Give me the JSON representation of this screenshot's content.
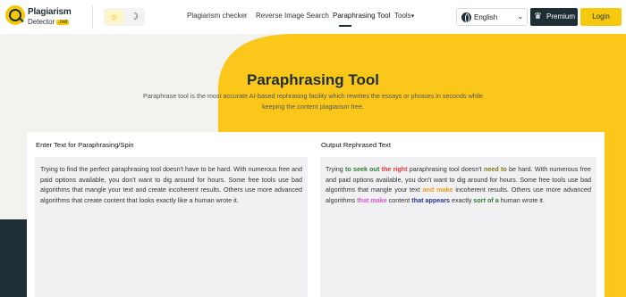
{
  "header": {
    "logo": {
      "line1": "Plagiarism",
      "line2": "Detector",
      "badge": ".net"
    },
    "theme": {
      "light_icon": "sun-icon",
      "dark_icon": "moon-icon"
    },
    "nav": [
      {
        "label": "Plagiarism checker"
      },
      {
        "label": "Reverse Image Search"
      },
      {
        "label": "Paraphrasing Tool",
        "active": true
      },
      {
        "label": "Tools"
      }
    ],
    "tools_chevron": "chevron-down-icon",
    "language": {
      "selected": "English",
      "icon": "globe-icon"
    },
    "premium_label": "Premium",
    "premium_icon": "crown-icon",
    "login_label": "Login"
  },
  "hero": {
    "title": "Paraphrasing Tool",
    "subtitle": "Paraphrase tool is the most accurate AI-based rephrasing facility which rewrites the essays or phrases in seconds while keeping the content plagiarism free."
  },
  "input_panel": {
    "heading": "Enter Text for Paraphrasing/Spin",
    "text": "Trying to find the perfect paraphrasing tool doesn't have to be hard. With numerous free and paid options available, you don't want to dig around for hours. Some free tools use bad algorithms that mangle your text and create incoherent results. Others use more advanced algorithms that create content that looks exactly like a human wrote it."
  },
  "output_panel": {
    "heading": "Output Rephrased Text",
    "segments": [
      {
        "text": "Trying ",
        "color": null
      },
      {
        "text": "to seek out",
        "color": "#2e7d32"
      },
      {
        "text": " ",
        "color": null
      },
      {
        "text": "the right",
        "color": "#e53935"
      },
      {
        "text": " paraphrasing tool doesn't ",
        "color": null
      },
      {
        "text": "need to",
        "color": "#827717"
      },
      {
        "text": " be hard. With numerous free and paid options available, you don't want to dig around for hours. Some free tools use bad algorithms that mangle your text ",
        "color": null
      },
      {
        "text": "and make",
        "color": "#f39c12"
      },
      {
        "text": " incoherent results. Others use more advanced algorithms ",
        "color": null
      },
      {
        "text": "that make",
        "color": "#e056d3"
      },
      {
        "text": " content ",
        "color": null
      },
      {
        "text": "that appears",
        "color": "#283593"
      },
      {
        "text": " exactly ",
        "color": null
      },
      {
        "text": "sort of a",
        "color": "#2e7d32"
      },
      {
        "text": " human wrote it.",
        "color": null
      }
    ]
  },
  "colors": {
    "brand_dark": "#1d2e35",
    "brand_yellow": "#f6c90e",
    "page_bg": "#f3f2ee"
  }
}
